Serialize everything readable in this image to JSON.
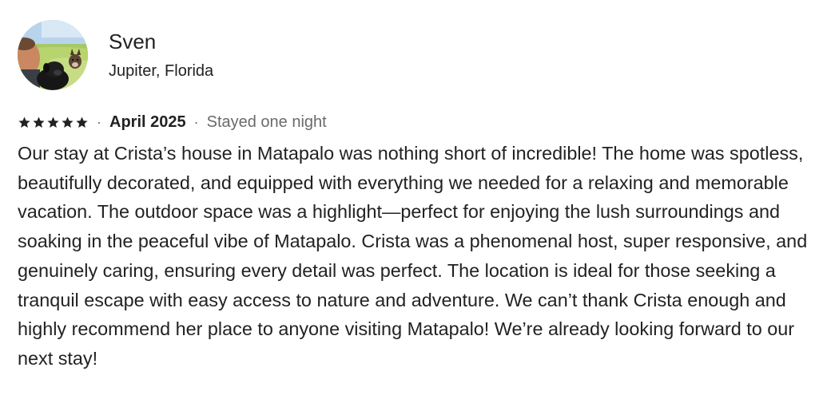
{
  "reviewer": {
    "name": "Sven",
    "location": "Jupiter, Florida",
    "avatar_icon": "user-photo-with-dogs"
  },
  "rating": {
    "stars": 5,
    "max_stars": 5,
    "star_icon": "star-icon",
    "star_color": "#222222"
  },
  "meta": {
    "separator": "·",
    "date": "April 2025",
    "stay_length": "Stayed one night"
  },
  "review": {
    "text": "Our stay at Crista’s house in Matapalo was nothing short of incredible! The home was spotless, beautifully decorated, and equipped with everything we needed for a relaxing and memorable vacation. The outdoor space was a highlight—perfect for enjoying the lush surroundings and soaking in the peaceful vibe of Matapalo. Crista was a phenomenal host, super responsive, and genuinely caring, ensuring every detail was perfect. The location is ideal for those seeking a tranquil escape with easy access to nature and adventure. We can’t thank Crista enough and highly recommend her place to anyone visiting Matapalo! We’re already looking forward to our next stay!"
  },
  "colors": {
    "text_primary": "#222222",
    "text_secondary": "#6a6a6a",
    "background": "#ffffff"
  }
}
